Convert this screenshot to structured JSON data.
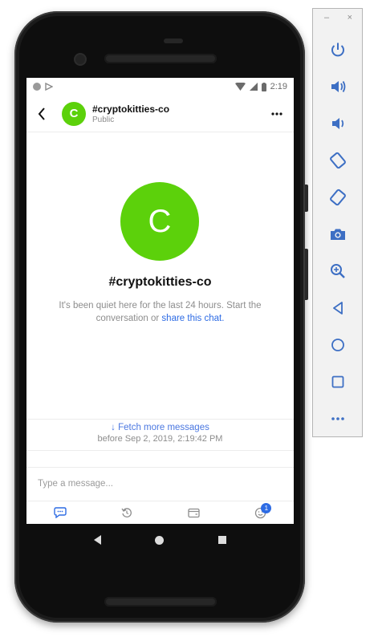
{
  "status_bar": {
    "time": "2:19"
  },
  "header": {
    "avatar_letter": "C",
    "title": "#cryptokitties-co",
    "subtitle": "Public"
  },
  "empty_state": {
    "avatar_letter": "C",
    "chat_name": "#cryptokitties-co",
    "quiet_text": "It's been quiet here for the last 24 hours. Start the conversation or",
    "share_link": "share this chat."
  },
  "history": {
    "fetch_label": "↓ Fetch more messages",
    "before_text": "before Sep 2, 2019, 2:19:42 PM"
  },
  "composer": {
    "placeholder": "Type a message..."
  },
  "toolbar": {
    "items": [
      {
        "icon": "chat-bubble-icon",
        "active": true
      },
      {
        "icon": "history-icon",
        "active": false
      },
      {
        "icon": "wallet-icon",
        "active": false
      },
      {
        "icon": "emoji-icon",
        "active": false,
        "badge": "1"
      }
    ]
  },
  "emulator_panel": {
    "minimize": "–",
    "close": "×",
    "buttons": [
      "power-icon",
      "volume-up-icon",
      "volume-down-icon",
      "rotate-left-icon",
      "rotate-right-icon",
      "camera-icon",
      "zoom-icon",
      "back-icon",
      "home-icon",
      "overview-icon",
      "more-icon"
    ]
  },
  "colors": {
    "accent_green": "#5cd10b",
    "link_blue": "#2d6be4",
    "emulator_icon_blue": "#3d6fc4"
  }
}
